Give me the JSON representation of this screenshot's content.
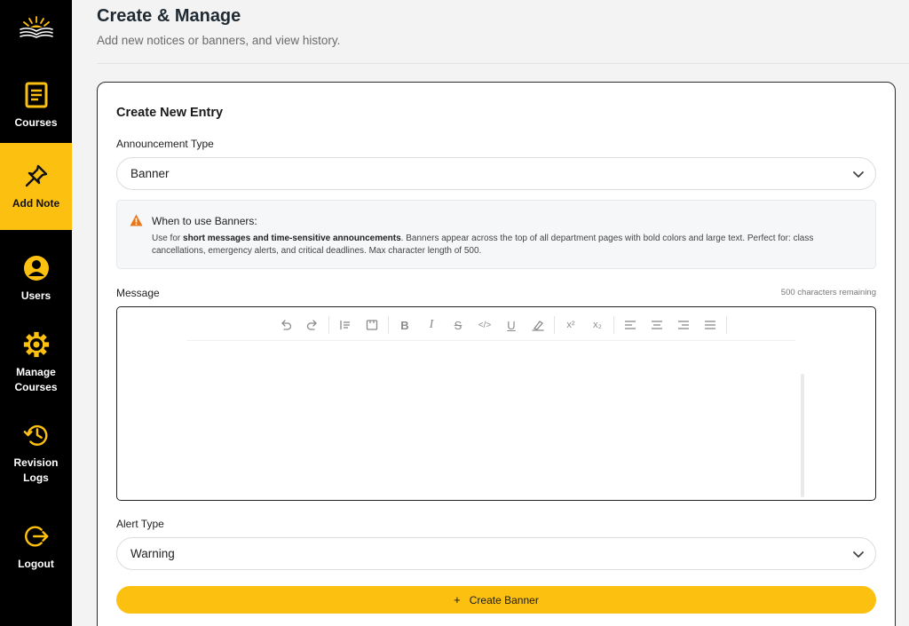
{
  "sidebar": {
    "logo_icon": "book-sunrise-icon",
    "items": [
      {
        "label": "Courses",
        "icon": "document-icon",
        "active": false
      },
      {
        "label": "Add Note",
        "icon": "pin-icon",
        "active": true
      },
      {
        "label": "Users",
        "icon": "user-circle-icon",
        "active": false
      },
      {
        "label": "Manage\nCourses",
        "icon": "gear-icon",
        "active": false
      },
      {
        "label": "Revision\nLogs",
        "icon": "history-icon",
        "active": false
      },
      {
        "label": "Logout",
        "icon": "logout-icon",
        "active": false
      }
    ]
  },
  "header": {
    "title": "Create & Manage",
    "subtitle": "Add new notices or banners, and view history."
  },
  "form": {
    "title": "Create New Entry",
    "announcement_type_label": "Announcement Type",
    "announcement_type_value": "Banner",
    "info": {
      "title": "When to use Banners:",
      "text_prefix": "Use for ",
      "text_bold": "short messages and time-sensitive announcements",
      "text_suffix": ". Banners appear across the top of all department pages with bold colors and large text. Perfect for: class cancellations, emergency alerts, and critical deadlines. Max character length of 500."
    },
    "message_label": "Message",
    "chars_remaining": "500 characters remaining",
    "toolbar": {
      "undo": "undo-icon",
      "redo": "redo-icon",
      "blockquote": "blockquote-icon",
      "code_block": "code-block-icon",
      "bold": "B",
      "italic": "I",
      "strike": "S",
      "code": "</>",
      "underline": "U",
      "highlight": "highlight-icon",
      "superscript": "x²",
      "subscript": "x₂",
      "align_left": "align-left-icon",
      "align_center": "align-center-icon",
      "align_right": "align-right-icon",
      "align_justify": "align-justify-icon"
    },
    "alert_type_label": "Alert Type",
    "alert_type_value": "Warning",
    "submit_label": "Create Banner",
    "submit_icon": "+"
  },
  "colors": {
    "accent": "#fcc010",
    "sidebar_bg": "#000000",
    "warning": "#e8761b"
  }
}
